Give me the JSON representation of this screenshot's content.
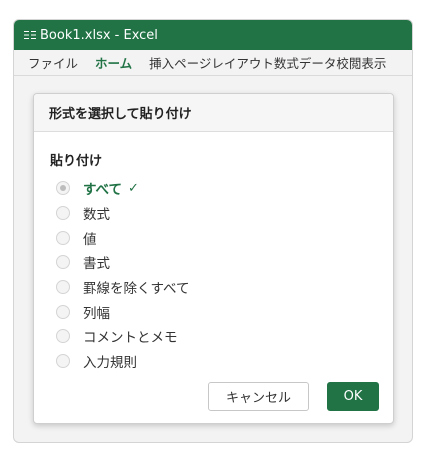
{
  "window": {
    "title": "Book1.xlsx - Excel",
    "accent_color": "#217346"
  },
  "menubar": {
    "items": [
      {
        "label": "ファイル",
        "active": false
      },
      {
        "label": "ホーム",
        "active": true
      }
    ],
    "ribbon_rest": "挿入ページレイアウト数式データ校閲表示"
  },
  "dialog": {
    "title": "形式を選択して貼り付け",
    "section_label": "貼り付け",
    "options": [
      {
        "label": "すべて",
        "checked": true
      },
      {
        "label": "数式",
        "checked": false
      },
      {
        "label": "値",
        "checked": false
      },
      {
        "label": "書式",
        "checked": false
      },
      {
        "label": "罫線を除くすべて",
        "checked": false
      },
      {
        "label": "列幅",
        "checked": false
      },
      {
        "label": "コメントとメモ",
        "checked": false
      },
      {
        "label": "入力規則",
        "checked": false
      }
    ],
    "selected_mark": "✓",
    "cancel_label": "キャンセル",
    "ok_label": "OK"
  }
}
